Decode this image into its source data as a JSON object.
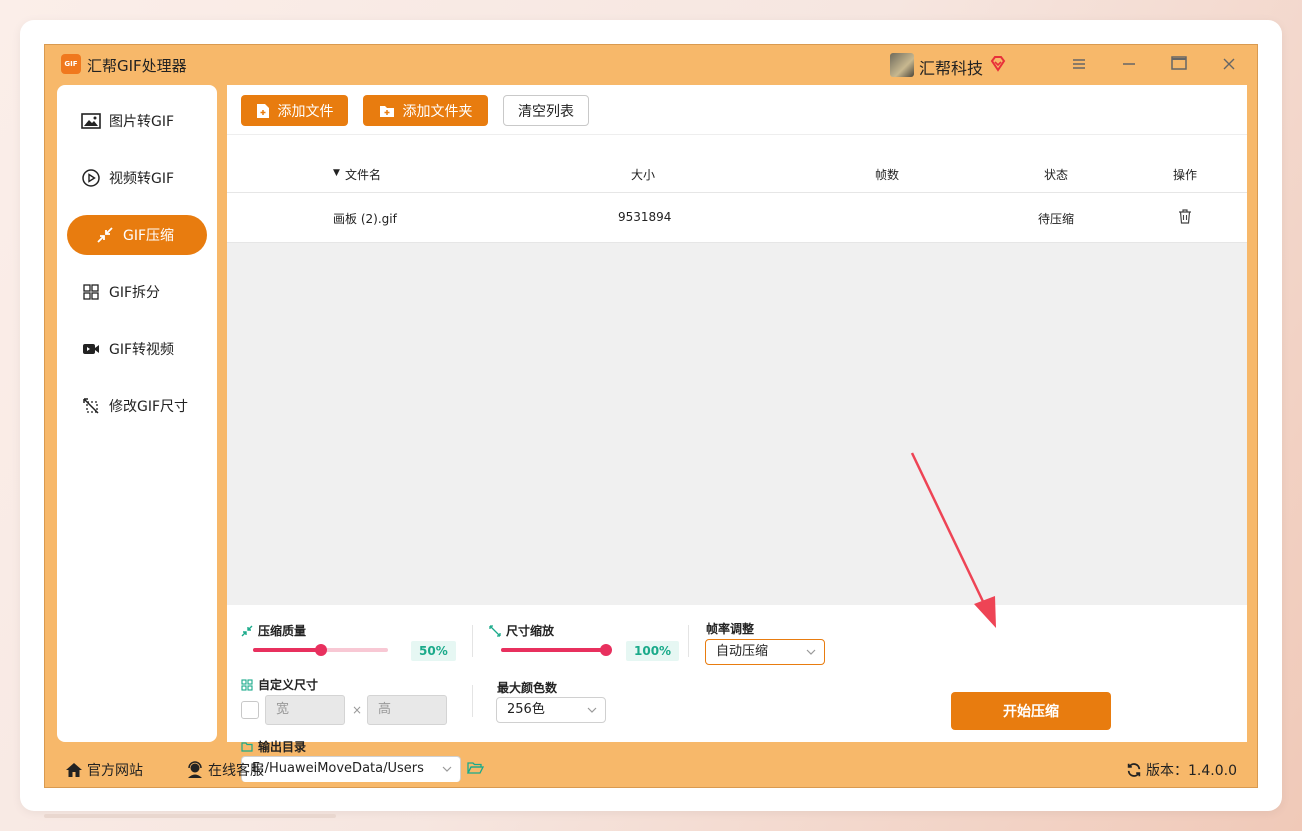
{
  "app": {
    "title": "汇帮GIF处理器",
    "logo_text": "GIF",
    "user_name": "汇帮科技"
  },
  "colors": {
    "accent": "#e87c0f",
    "window_bg": "#f7b86a",
    "slider": "#e8305e",
    "badge_text": "#1aaa8a"
  },
  "sidebar": {
    "items": [
      {
        "label": "图片转GIF",
        "icon": "image-icon",
        "active": false
      },
      {
        "label": "视频转GIF",
        "icon": "play-icon",
        "active": false
      },
      {
        "label": "GIF压缩",
        "icon": "compress-icon",
        "active": true
      },
      {
        "label": "GIF拆分",
        "icon": "split-grid-icon",
        "active": false
      },
      {
        "label": "GIF转视频",
        "icon": "video-camera-icon",
        "active": false
      },
      {
        "label": "修改GIF尺寸",
        "icon": "resize-icon",
        "active": false
      }
    ]
  },
  "toolbar": {
    "add_file": "添加文件",
    "add_folder": "添加文件夹",
    "clear_list": "清空列表"
  },
  "table": {
    "headers": {
      "name": "文件名",
      "size": "大小",
      "frames": "帧数",
      "status": "状态",
      "action": "操作"
    },
    "rows": [
      {
        "name": "画板 (2).gif",
        "size": "9531894",
        "frames": "",
        "status": "待压缩"
      }
    ]
  },
  "settings": {
    "quality": {
      "label": "压缩质量",
      "value": "50%",
      "fraction": 0.5
    },
    "scale": {
      "label": "尺寸缩放",
      "value": "100%",
      "fraction": 1.0
    },
    "framerate": {
      "label": "帧率调整",
      "selected": "自动压缩"
    },
    "custom_size": {
      "label": "自定义尺寸",
      "width_placeholder": "宽",
      "height_placeholder": "高",
      "times": "×"
    },
    "max_colors": {
      "label": "最大颜色数",
      "selected": "256色"
    },
    "output_dir": {
      "label": "输出目录",
      "value": "E:/HuaweiMoveData/Users"
    },
    "start_button": "开始压缩"
  },
  "statusbar": {
    "website": "官方网站",
    "support": "在线客服",
    "version": "版本：1.4.0.0"
  }
}
